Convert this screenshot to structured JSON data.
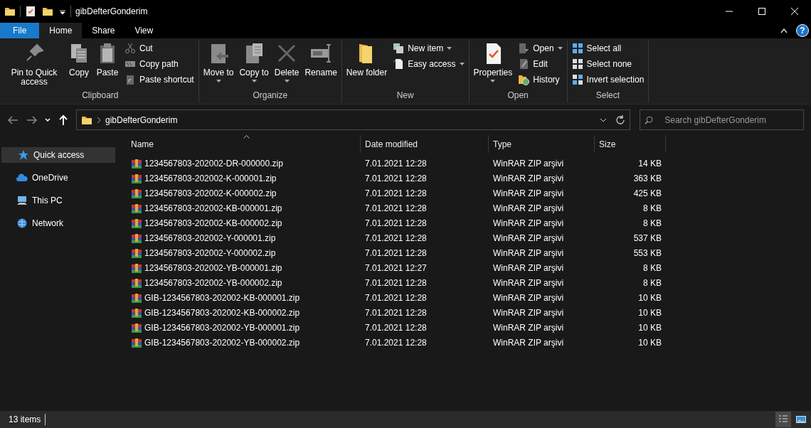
{
  "window": {
    "title": "gibDefterGonderim"
  },
  "ribbon": {
    "tabs": [
      {
        "label": "File",
        "kind": "file",
        "selected": false
      },
      {
        "label": "Home",
        "kind": "tab",
        "selected": true
      },
      {
        "label": "Share",
        "kind": "tab",
        "selected": false
      },
      {
        "label": "View",
        "kind": "tab",
        "selected": false
      }
    ],
    "help": "?",
    "groups": [
      {
        "label": "Clipboard",
        "items": [
          {
            "label": "Pin to Quick access",
            "kind": "large",
            "dropdown": false
          },
          {
            "label": "Copy",
            "kind": "large",
            "dropdown": false
          },
          {
            "label": "Paste",
            "kind": "large",
            "dropdown": false
          },
          {
            "label": "Cut",
            "kind": "small",
            "dropdown": false
          },
          {
            "label": "Copy path",
            "kind": "small",
            "dropdown": false
          },
          {
            "label": "Paste shortcut",
            "kind": "small",
            "dropdown": false
          }
        ]
      },
      {
        "label": "Organize",
        "items": [
          {
            "label": "Move to",
            "kind": "large",
            "dropdown": true
          },
          {
            "label": "Copy to",
            "kind": "large",
            "dropdown": true
          },
          {
            "label": "Delete",
            "kind": "large",
            "dropdown": true
          },
          {
            "label": "Rename",
            "kind": "large",
            "dropdown": false
          }
        ]
      },
      {
        "label": "New",
        "items": [
          {
            "label": "New folder",
            "kind": "large",
            "dropdown": false
          },
          {
            "label": "New item",
            "kind": "small",
            "dropdown": true
          },
          {
            "label": "Easy access",
            "kind": "small",
            "dropdown": true
          }
        ]
      },
      {
        "label": "Open",
        "items": [
          {
            "label": "Properties",
            "kind": "large",
            "dropdown": true
          },
          {
            "label": "Open",
            "kind": "small",
            "dropdown": true
          },
          {
            "label": "Edit",
            "kind": "small",
            "dropdown": false
          },
          {
            "label": "History",
            "kind": "small",
            "dropdown": false
          }
        ]
      },
      {
        "label": "Select",
        "items": [
          {
            "label": "Select all",
            "kind": "small",
            "dropdown": false
          },
          {
            "label": "Select none",
            "kind": "small",
            "dropdown": false
          },
          {
            "label": "Invert selection",
            "kind": "small",
            "dropdown": false
          }
        ]
      }
    ]
  },
  "nav_buttons": [
    {
      "kind": "back",
      "disabled": true
    },
    {
      "kind": "forward",
      "disabled": true
    },
    {
      "kind": "recent",
      "disabled": false
    },
    {
      "kind": "up",
      "disabled": false
    }
  ],
  "address": {
    "path": "gibDefterGonderim"
  },
  "search": {
    "placeholder": "Search gibDefterGonderim"
  },
  "sidebar": {
    "items": [
      {
        "label": "Quick access",
        "selected": true
      },
      {
        "label": "OneDrive",
        "selected": false
      },
      {
        "label": "This PC",
        "selected": false
      },
      {
        "label": "Network",
        "selected": false
      }
    ]
  },
  "table": {
    "columns": [
      {
        "label": "Name",
        "sorted": true
      },
      {
        "label": "Date modified",
        "sorted": false
      },
      {
        "label": "Type",
        "sorted": false
      },
      {
        "label": "Size",
        "sorted": false
      }
    ],
    "rows": [
      {
        "name": "1234567803-202002-DR-000000.zip",
        "date": "7.01.2021 12:28",
        "type": "WinRAR ZIP arşivi",
        "size": "14 KB"
      },
      {
        "name": "1234567803-202002-K-000001.zip",
        "date": "7.01.2021 12:28",
        "type": "WinRAR ZIP arşivi",
        "size": "363 KB"
      },
      {
        "name": "1234567803-202002-K-000002.zip",
        "date": "7.01.2021 12:28",
        "type": "WinRAR ZIP arşivi",
        "size": "425 KB"
      },
      {
        "name": "1234567803-202002-KB-000001.zip",
        "date": "7.01.2021 12:28",
        "type": "WinRAR ZIP arşivi",
        "size": "8 KB"
      },
      {
        "name": "1234567803-202002-KB-000002.zip",
        "date": "7.01.2021 12:28",
        "type": "WinRAR ZIP arşivi",
        "size": "8 KB"
      },
      {
        "name": "1234567803-202002-Y-000001.zip",
        "date": "7.01.2021 12:28",
        "type": "WinRAR ZIP arşivi",
        "size": "537 KB"
      },
      {
        "name": "1234567803-202002-Y-000002.zip",
        "date": "7.01.2021 12:28",
        "type": "WinRAR ZIP arşivi",
        "size": "553 KB"
      },
      {
        "name": "1234567803-202002-YB-000001.zip",
        "date": "7.01.2021 12:27",
        "type": "WinRAR ZIP arşivi",
        "size": "8 KB"
      },
      {
        "name": "1234567803-202002-YB-000002.zip",
        "date": "7.01.2021 12:28",
        "type": "WinRAR ZIP arşivi",
        "size": "8 KB"
      },
      {
        "name": "GIB-1234567803-202002-KB-000001.zip",
        "date": "7.01.2021 12:28",
        "type": "WinRAR ZIP arşivi",
        "size": "10 KB"
      },
      {
        "name": "GIB-1234567803-202002-KB-000002.zip",
        "date": "7.01.2021 12:28",
        "type": "WinRAR ZIP arşivi",
        "size": "10 KB"
      },
      {
        "name": "GIB-1234567803-202002-YB-000001.zip",
        "date": "7.01.2021 12:28",
        "type": "WinRAR ZIP arşivi",
        "size": "10 KB"
      },
      {
        "name": "GIB-1234567803-202002-YB-000002.zip",
        "date": "7.01.2021 12:28",
        "type": "WinRAR ZIP arşivi",
        "size": "10 KB"
      }
    ]
  },
  "status_bar": {
    "text": "13 items",
    "views": [
      {
        "kind": "details",
        "selected": true
      },
      {
        "kind": "large_icons",
        "selected": false
      }
    ]
  }
}
